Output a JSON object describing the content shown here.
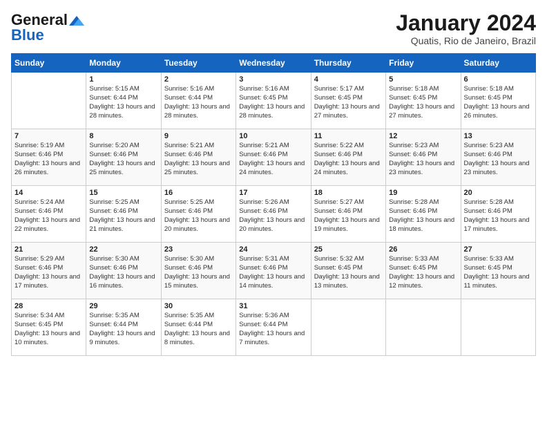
{
  "header": {
    "logo_general": "General",
    "logo_blue": "Blue",
    "month_title": "January 2024",
    "subtitle": "Quatis, Rio de Janeiro, Brazil"
  },
  "days_of_week": [
    "Sunday",
    "Monday",
    "Tuesday",
    "Wednesday",
    "Thursday",
    "Friday",
    "Saturday"
  ],
  "weeks": [
    [
      {
        "day": "",
        "sunrise": "",
        "sunset": "",
        "daylight": ""
      },
      {
        "day": "1",
        "sunrise": "Sunrise: 5:15 AM",
        "sunset": "Sunset: 6:44 PM",
        "daylight": "Daylight: 13 hours and 28 minutes."
      },
      {
        "day": "2",
        "sunrise": "Sunrise: 5:16 AM",
        "sunset": "Sunset: 6:44 PM",
        "daylight": "Daylight: 13 hours and 28 minutes."
      },
      {
        "day": "3",
        "sunrise": "Sunrise: 5:16 AM",
        "sunset": "Sunset: 6:45 PM",
        "daylight": "Daylight: 13 hours and 28 minutes."
      },
      {
        "day": "4",
        "sunrise": "Sunrise: 5:17 AM",
        "sunset": "Sunset: 6:45 PM",
        "daylight": "Daylight: 13 hours and 27 minutes."
      },
      {
        "day": "5",
        "sunrise": "Sunrise: 5:18 AM",
        "sunset": "Sunset: 6:45 PM",
        "daylight": "Daylight: 13 hours and 27 minutes."
      },
      {
        "day": "6",
        "sunrise": "Sunrise: 5:18 AM",
        "sunset": "Sunset: 6:45 PM",
        "daylight": "Daylight: 13 hours and 26 minutes."
      }
    ],
    [
      {
        "day": "7",
        "sunrise": "Sunrise: 5:19 AM",
        "sunset": "Sunset: 6:46 PM",
        "daylight": "Daylight: 13 hours and 26 minutes."
      },
      {
        "day": "8",
        "sunrise": "Sunrise: 5:20 AM",
        "sunset": "Sunset: 6:46 PM",
        "daylight": "Daylight: 13 hours and 25 minutes."
      },
      {
        "day": "9",
        "sunrise": "Sunrise: 5:21 AM",
        "sunset": "Sunset: 6:46 PM",
        "daylight": "Daylight: 13 hours and 25 minutes."
      },
      {
        "day": "10",
        "sunrise": "Sunrise: 5:21 AM",
        "sunset": "Sunset: 6:46 PM",
        "daylight": "Daylight: 13 hours and 24 minutes."
      },
      {
        "day": "11",
        "sunrise": "Sunrise: 5:22 AM",
        "sunset": "Sunset: 6:46 PM",
        "daylight": "Daylight: 13 hours and 24 minutes."
      },
      {
        "day": "12",
        "sunrise": "Sunrise: 5:23 AM",
        "sunset": "Sunset: 6:46 PM",
        "daylight": "Daylight: 13 hours and 23 minutes."
      },
      {
        "day": "13",
        "sunrise": "Sunrise: 5:23 AM",
        "sunset": "Sunset: 6:46 PM",
        "daylight": "Daylight: 13 hours and 23 minutes."
      }
    ],
    [
      {
        "day": "14",
        "sunrise": "Sunrise: 5:24 AM",
        "sunset": "Sunset: 6:46 PM",
        "daylight": "Daylight: 13 hours and 22 minutes."
      },
      {
        "day": "15",
        "sunrise": "Sunrise: 5:25 AM",
        "sunset": "Sunset: 6:46 PM",
        "daylight": "Daylight: 13 hours and 21 minutes."
      },
      {
        "day": "16",
        "sunrise": "Sunrise: 5:25 AM",
        "sunset": "Sunset: 6:46 PM",
        "daylight": "Daylight: 13 hours and 20 minutes."
      },
      {
        "day": "17",
        "sunrise": "Sunrise: 5:26 AM",
        "sunset": "Sunset: 6:46 PM",
        "daylight": "Daylight: 13 hours and 20 minutes."
      },
      {
        "day": "18",
        "sunrise": "Sunrise: 5:27 AM",
        "sunset": "Sunset: 6:46 PM",
        "daylight": "Daylight: 13 hours and 19 minutes."
      },
      {
        "day": "19",
        "sunrise": "Sunrise: 5:28 AM",
        "sunset": "Sunset: 6:46 PM",
        "daylight": "Daylight: 13 hours and 18 minutes."
      },
      {
        "day": "20",
        "sunrise": "Sunrise: 5:28 AM",
        "sunset": "Sunset: 6:46 PM",
        "daylight": "Daylight: 13 hours and 17 minutes."
      }
    ],
    [
      {
        "day": "21",
        "sunrise": "Sunrise: 5:29 AM",
        "sunset": "Sunset: 6:46 PM",
        "daylight": "Daylight: 13 hours and 17 minutes."
      },
      {
        "day": "22",
        "sunrise": "Sunrise: 5:30 AM",
        "sunset": "Sunset: 6:46 PM",
        "daylight": "Daylight: 13 hours and 16 minutes."
      },
      {
        "day": "23",
        "sunrise": "Sunrise: 5:30 AM",
        "sunset": "Sunset: 6:46 PM",
        "daylight": "Daylight: 13 hours and 15 minutes."
      },
      {
        "day": "24",
        "sunrise": "Sunrise: 5:31 AM",
        "sunset": "Sunset: 6:46 PM",
        "daylight": "Daylight: 13 hours and 14 minutes."
      },
      {
        "day": "25",
        "sunrise": "Sunrise: 5:32 AM",
        "sunset": "Sunset: 6:45 PM",
        "daylight": "Daylight: 13 hours and 13 minutes."
      },
      {
        "day": "26",
        "sunrise": "Sunrise: 5:33 AM",
        "sunset": "Sunset: 6:45 PM",
        "daylight": "Daylight: 13 hours and 12 minutes."
      },
      {
        "day": "27",
        "sunrise": "Sunrise: 5:33 AM",
        "sunset": "Sunset: 6:45 PM",
        "daylight": "Daylight: 13 hours and 11 minutes."
      }
    ],
    [
      {
        "day": "28",
        "sunrise": "Sunrise: 5:34 AM",
        "sunset": "Sunset: 6:45 PM",
        "daylight": "Daylight: 13 hours and 10 minutes."
      },
      {
        "day": "29",
        "sunrise": "Sunrise: 5:35 AM",
        "sunset": "Sunset: 6:44 PM",
        "daylight": "Daylight: 13 hours and 9 minutes."
      },
      {
        "day": "30",
        "sunrise": "Sunrise: 5:35 AM",
        "sunset": "Sunset: 6:44 PM",
        "daylight": "Daylight: 13 hours and 8 minutes."
      },
      {
        "day": "31",
        "sunrise": "Sunrise: 5:36 AM",
        "sunset": "Sunset: 6:44 PM",
        "daylight": "Daylight: 13 hours and 7 minutes."
      },
      {
        "day": "",
        "sunrise": "",
        "sunset": "",
        "daylight": ""
      },
      {
        "day": "",
        "sunrise": "",
        "sunset": "",
        "daylight": ""
      },
      {
        "day": "",
        "sunrise": "",
        "sunset": "",
        "daylight": ""
      }
    ]
  ]
}
